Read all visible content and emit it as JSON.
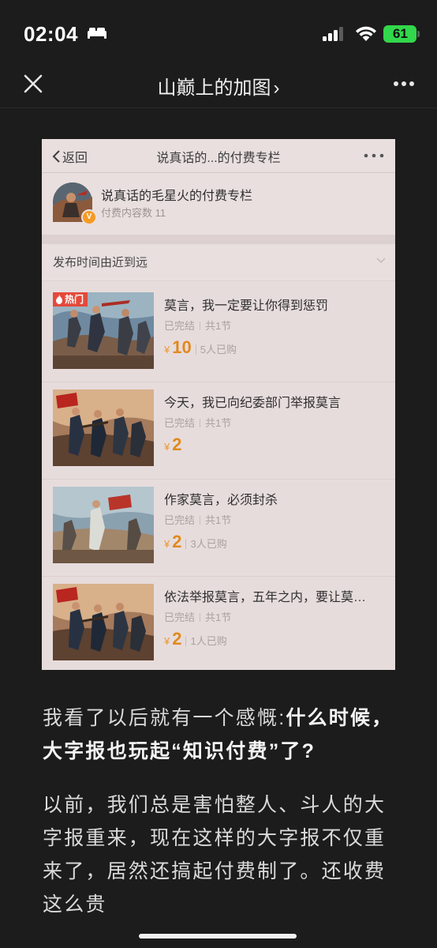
{
  "status_bar": {
    "time": "02:04",
    "battery_level": "61"
  },
  "nav": {
    "title": "山巅上的加图",
    "chevron": "›",
    "icons": {
      "close": "close-icon",
      "more": "more-dots-icon"
    }
  },
  "embedded_screenshot": {
    "nav": {
      "back_label": "返回",
      "title": "说真话的...的付费专栏"
    },
    "channel": {
      "name": "说真话的毛星火的付费专栏",
      "content_count": "付费内容数 11",
      "verified_mark": "V"
    },
    "sort_label": "发布时间由近到远",
    "items": [
      {
        "title": "莫言，我一定要让你得到惩罚",
        "status": "已完结",
        "sections": "共1节",
        "currency": "¥",
        "price": "10",
        "buyers": "5人已购",
        "badge": "热门"
      },
      {
        "title": "今天，我已向纪委部门举报莫言",
        "status": "已完结",
        "sections": "共1节",
        "currency": "¥",
        "price": "2",
        "buyers": ""
      },
      {
        "title": "作家莫言，必须封杀",
        "status": "已完结",
        "sections": "共1节",
        "currency": "¥",
        "price": "2",
        "buyers": "3人已购"
      },
      {
        "title": "依法举报莫言，五年之内，要让莫…",
        "status": "已完结",
        "sections": "共1节",
        "currency": "¥",
        "price": "2",
        "buyers": "1人已购"
      }
    ]
  },
  "article": {
    "paragraph1_plain": "我看了以后就有一个感慨:",
    "paragraph1_bold": "什么时候，大字报也玩起“知识付费”了?",
    "paragraph2": "以前，我们总是害怕整人、斗人的大字报重来，现在这样的大字报不仅重来了，居然还搞起付费制了。还收费这么贵"
  },
  "colors": {
    "background": "#1c1c1c",
    "embedded_background": "#e7dcdc",
    "price_orange": "#e08a1e",
    "hot_badge": "#e4493a",
    "battery_green": "#32d74b"
  }
}
